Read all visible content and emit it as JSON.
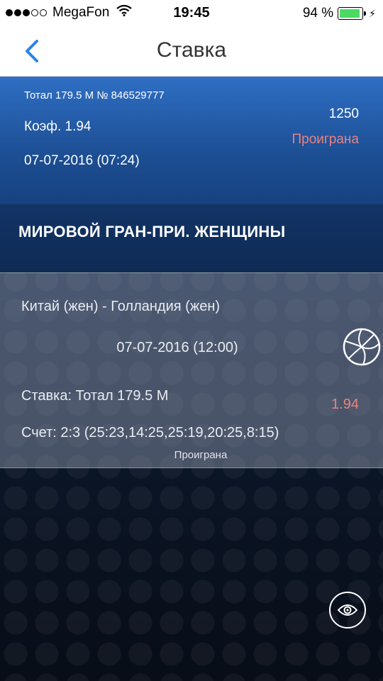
{
  "status_bar": {
    "carrier": "MegaFon",
    "time": "19:45",
    "battery": "94 %",
    "battery_level": 0.94,
    "battery_color": "#4cd964"
  },
  "nav": {
    "title": "Ставка",
    "back_icon": "chevron-left-icon",
    "accent": "#2b83e8"
  },
  "bet": {
    "title": "Тотал 179.5 М  № 846529777",
    "coef": "Коэф. 1.94",
    "datetime": "07-07-2016 (07:24)",
    "amount": "1250",
    "status": "Проиграна",
    "status_color": "#e8827f"
  },
  "league": {
    "name": "МИРОВОЙ ГРАН-ПРИ. ЖЕНЩИНЫ"
  },
  "event": {
    "teams": "Китай (жен) - Голландия (жен)",
    "datetime": "07-07-2016 (12:00)",
    "sport_icon": "volleyball-icon",
    "stake": "Ставка: Тотал 179.5 М",
    "coef": "1.94",
    "score": "Счет: 2:3 (25:23,14:25,25:19,20:25,8:15)",
    "status": "Проиграна"
  },
  "actions": {
    "eye_icon": "eye-icon"
  }
}
